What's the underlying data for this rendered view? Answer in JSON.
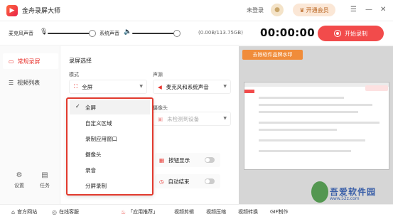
{
  "app": {
    "title": "金舟录屏大师",
    "logo_glyph": "▶"
  },
  "header": {
    "login_label": "未登录",
    "vip_label": "开通会员",
    "vip_icon": "crown-icon"
  },
  "window_controls": {
    "menu": "☰",
    "minimize": "—",
    "close": "✕"
  },
  "toolbar": {
    "mic_label": "麦克风声音",
    "mic_icon": "microphone-icon",
    "system_label": "系统声音",
    "speaker_icon": "speaker-icon",
    "disk": "(0.00B/113.75GB)",
    "timer": "00:00:00",
    "record_button": "开始录制",
    "accent": "#f24b4b"
  },
  "sidebar": {
    "items": [
      {
        "label": "常规录屏",
        "icon": "record-icon",
        "active": true
      },
      {
        "label": "视频列表",
        "icon": "list-icon",
        "active": false
      }
    ],
    "settings_label": "设置",
    "tasks_label": "任务"
  },
  "main": {
    "section_title": "录屏选择",
    "mode_label": "模式",
    "mode_value": "全屏",
    "audio_label": "声源",
    "audio_value": "麦克风和系统声音",
    "camera_label": "摄像头",
    "camera_value": "未检测到设备",
    "toggle_button_label": "按钮显示",
    "toggle_end_label": "自动结束"
  },
  "dropdown": {
    "options": [
      "全屏",
      "自定义区域",
      "录制应用窗口",
      "摄像头",
      "录音",
      "分屏录制"
    ],
    "selected": "全屏",
    "border_color": "#e23a2e"
  },
  "preview": {
    "watermark_button": "去除软件品牌水印"
  },
  "overlay_watermark": {
    "text": "吾爱软件园",
    "url": "www.52z.com"
  },
  "statusbar": {
    "website": "官方网站",
    "support": "在线客服",
    "recommend": "「应用推荐」",
    "tools": [
      "视频剪辑",
      "视频压缩",
      "视频转换",
      "GIF制作"
    ]
  }
}
